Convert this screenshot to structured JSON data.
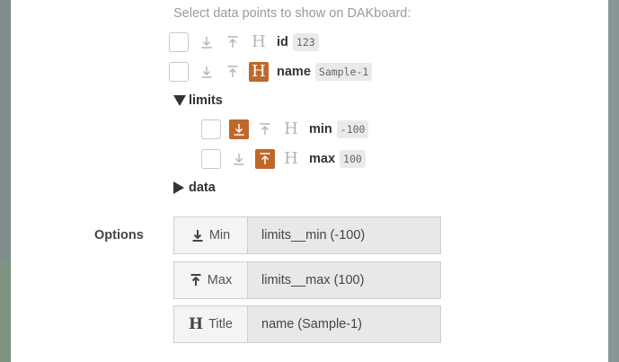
{
  "hint": "Select data points to show on DAKboard:",
  "fields": [
    {
      "name": "id",
      "value": "123",
      "min_active": false,
      "max_active": false,
      "title_active": false
    },
    {
      "name": "name",
      "value": "Sample-1",
      "min_active": false,
      "max_active": false,
      "title_active": true
    }
  ],
  "groups": {
    "limits": {
      "label": "limits",
      "expanded": true,
      "fields": [
        {
          "name": "min",
          "value": "-100",
          "min_active": true,
          "max_active": false,
          "title_active": false
        },
        {
          "name": "max",
          "value": "100",
          "min_active": false,
          "max_active": true,
          "title_active": false
        }
      ]
    },
    "data": {
      "label": "data",
      "expanded": false
    }
  },
  "options": {
    "label": "Options",
    "min": {
      "button": "Min",
      "value": "limits__min (-100)"
    },
    "max": {
      "button": "Max",
      "value": "limits__max (100)"
    },
    "title": {
      "button": "Title",
      "value": "name (Sample-1)"
    }
  },
  "icons": {
    "min": "arrow-down-to-line-icon",
    "max": "arrow-up-from-line-icon",
    "title": "heading-h-icon",
    "expanded": "caret-down-icon",
    "collapsed": "caret-right-icon"
  },
  "colors": {
    "accent": "#c0672a"
  }
}
